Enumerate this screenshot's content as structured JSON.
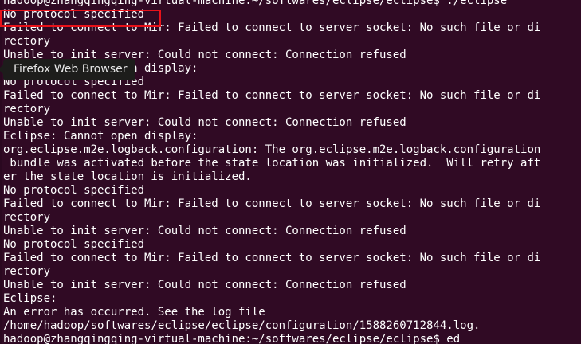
{
  "terminal": {
    "lines": [
      "hadoop@zhangqingqing-virtual-machine:~/softwares/eclipse/eclipse$ ./eclipse",
      "No protocol specified",
      "Failed to connect to Mir: Failed to connect to server socket: No such file or di",
      "rectory",
      "Unable to init server: Could not connect: Connection refused",
      "Eclipse: Cannot open display:",
      "No protocol specified",
      "Failed to connect to Mir: Failed to connect to server socket: No such file or di",
      "rectory",
      "Unable to init server: Could not connect: Connection refused",
      "Eclipse: Cannot open display:",
      "org.eclipse.m2e.logback.configuration: The org.eclipse.m2e.logback.configuration",
      " bundle was activated before the state location was initialized.  Will retry aft",
      "er the state location is initialized.",
      "No protocol specified",
      "Failed to connect to Mir: Failed to connect to server socket: No such file or di",
      "rectory",
      "Unable to init server: Could not connect: Connection refused",
      "No protocol specified",
      "Failed to connect to Mir: Failed to connect to server socket: No such file or di",
      "rectory",
      "Unable to init server: Could not connect: Connection refused",
      "Eclipse:",
      "An error has occurred. See the log file",
      "/home/hadoop/softwares/eclipse/eclipse/configuration/1588260712844.log.",
      "hadoop@zhangqingqing-virtual-machine:~/softwares/eclipse/eclipse$ ed"
    ],
    "background": "#300a24",
    "text_color": "#ffffff"
  },
  "tooltip": {
    "label": "Firefox Web Browser"
  },
  "highlight": {
    "color": "#e8121a"
  }
}
